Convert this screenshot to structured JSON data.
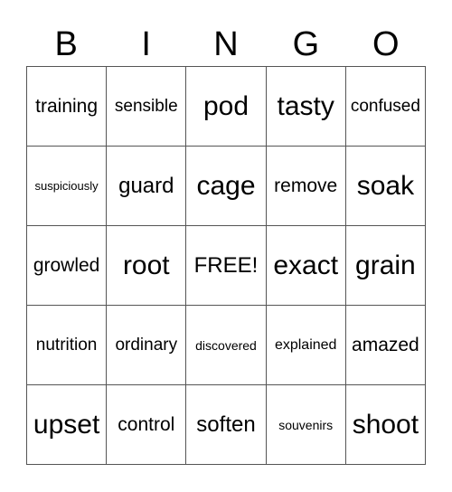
{
  "header": [
    "B",
    "I",
    "N",
    "G",
    "O"
  ],
  "cells": [
    [
      "training",
      "sensible",
      "pod",
      "tasty",
      "confused"
    ],
    [
      "suspiciously",
      "guard",
      "cage",
      "remove",
      "soak"
    ],
    [
      "growled",
      "root",
      "FREE!",
      "exact",
      "grain"
    ],
    [
      "nutrition",
      "ordinary",
      "discovered",
      "explained",
      "amazed"
    ],
    [
      "upset",
      "control",
      "soften",
      "souvenirs",
      "shoot"
    ]
  ]
}
